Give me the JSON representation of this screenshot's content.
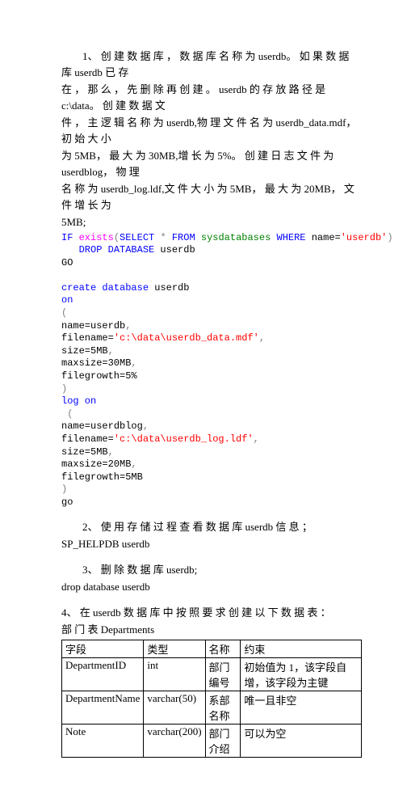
{
  "p1": {
    "line1": "1、 创 建 数 据 库 ， 数 据 库 名 称 为 userdb。 如 果 数 据 库 userdb 已 存",
    "line2": "在 ， 那 么 ， 先 删 除 再 创 建 。 userdb 的 存 放 路 径 是 c:\\data。 创 建 数 据 文",
    "line3": "件 ， 主 逻 辑 名 称 为 userdb,物 理 文 件 名 为 userdb_data.mdf， 初 始 大 小",
    "line4": "为 5MB， 最 大 为 30MB,增 长 为 5%。 创 建 日 志 文 件 为 userdblog， 物 理",
    "line5": "名 称 为 userdb_log.ldf,文 件 大 小 为 5MB， 最 大 为 20MB， 文 件 增 长 为",
    "line6": "5MB;"
  },
  "code1": {
    "l1a": "IF ",
    "l1b": "exists",
    "l1c": "(",
    "l1d": "SELECT",
    "l1e": " * ",
    "l1f": "FROM",
    "l1g": " sysdatabases ",
    "l1h": "WHERE",
    "l1i": " name=",
    "l1j": "'userdb'",
    "l1k": ")",
    "l2a": "   DROP",
    "l2b": " DATABASE",
    "l2c": " userdb",
    "l3": "GO",
    "l4": "",
    "l5a": "create",
    "l5b": " database",
    "l5c": " userdb",
    "l6": "on",
    "l7": "(",
    "l8a": "name=",
    "l8b": "userdb",
    "l8c": ",",
    "l9a": "filename=",
    "l9b": "'c:\\data\\userdb_data.mdf'",
    "l9c": ",",
    "l10a": "size=",
    "l10b": "5MB",
    "l10c": ",",
    "l11a": "maxsize=",
    "l11b": "30MB",
    "l11c": ",",
    "l12a": "filegrowth=",
    "l12b": "5%",
    "l13": ")",
    "l14a": "log",
    "l14b": " on",
    "l15": " (",
    "l16a": "name=",
    "l16b": "userdblog",
    "l16c": ",",
    "l17a": "filename=",
    "l17b": "'c:\\data\\userdb_log.ldf'",
    "l17c": ",",
    "l18a": "size=",
    "l18b": "5MB",
    "l18c": ",",
    "l19a": "maxsize=",
    "l19b": "20MB",
    "l19c": ",",
    "l20a": "filegrowth=",
    "l20b": "5MB",
    "l21": ")",
    "l22": "go"
  },
  "p2": {
    "line1": "2、 使 用 存 储 过 程 查 看 数 据 库 userdb 信 息 ；",
    "line2": "SP_HELPDB  userdb"
  },
  "p3": {
    "line1": "3、 删 除 数 据 库 userdb;",
    "line2": "drop  database  userdb"
  },
  "p4": {
    "line1": "4、 在 userdb 数 据 库 中 按 照 要 求 创 建 以 下 数 据 表 ：",
    "line2": "部 门 表  Departments"
  },
  "table": {
    "h1": "字段",
    "h2": "类型",
    "h3": "名称",
    "h4": "约束",
    "r1c1": "DepartmentID",
    "r1c2": "int",
    "r1c3": "部门编号",
    "r1c4": "初始值为 1，该字段自增，该字段为主键",
    "r2c1": "DepartmentName",
    "r2c2": "varchar(50)",
    "r2c3": "系部名称",
    "r2c4": "唯一且非空",
    "r3c1": "Note",
    "r3c2": "varchar(200)",
    "r3c3": "部门介绍",
    "r3c4": "可以为空"
  }
}
